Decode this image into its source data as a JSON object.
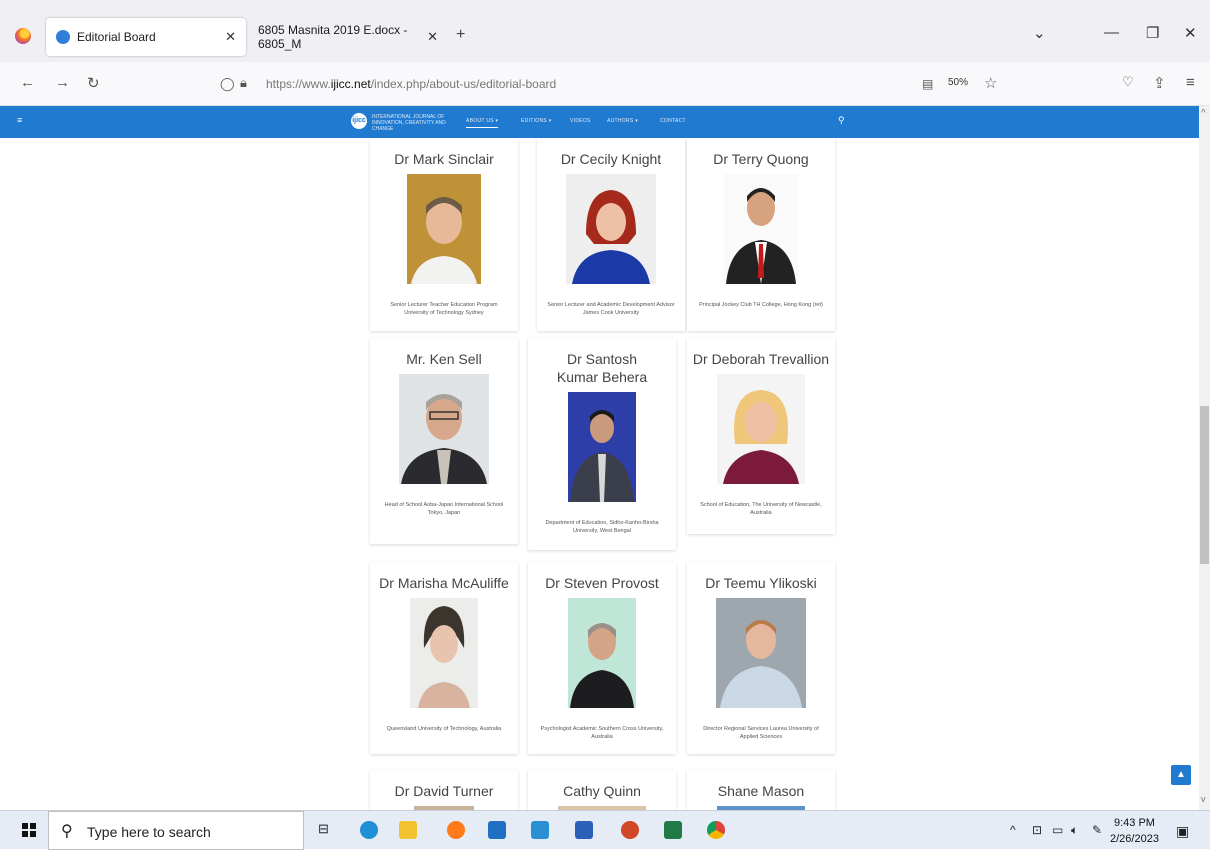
{
  "browser": {
    "tabs": [
      {
        "title": "Editorial Board",
        "active": true
      },
      {
        "title": "6805 Masnita 2019 E.docx - 6805_M",
        "active": false
      }
    ],
    "url_prefix": "https://www.",
    "url_domain": "ijicc.net",
    "url_path": "/index.php/about-us/editorial-board",
    "zoom": "50%"
  },
  "site": {
    "brand_line1": "INTERNATIONAL JOURNAL OF",
    "brand_line2": "INNOVATION, CREATIVITY AND CHANGE",
    "menu": [
      "ABOUT US ▾",
      "EDITIONS ▾",
      "VIDEOS",
      "AUTHORS ▾",
      "CONTACT"
    ]
  },
  "board": [
    {
      "name": "Dr Mark Sinclair",
      "role": "Senior Lecturer Teacher Education Program University of Technology Sydney"
    },
    {
      "name": "Dr Cecily Knight",
      "role": "Senior Lecturer and Academic Development Advisor James Cook University"
    },
    {
      "name": "Dr Terry Quong",
      "role": "Principal Jockey Club TH College, Hong Kong (ret)"
    },
    {
      "name": "Mr. Ken Sell",
      "role": "Head of School Aoba-Japan International School Tokyo, Japan"
    },
    {
      "name": "Dr Santosh Kumar Behera",
      "role": "Department of Education, Sidho-Kanho-Birsha University, West Bengal"
    },
    {
      "name": "Dr Deborah Trevallion",
      "role": "School of Education, The University of Newcastle, Australia"
    },
    {
      "name": "Dr Marisha McAuliffe",
      "role": "Queensland University of Technology, Australia"
    },
    {
      "name": "Dr Steven Provost",
      "role": "Psychologist Academic Southern Cross University, Australia"
    },
    {
      "name": "Dr Teemu Ylikoski",
      "role": "Director Regional Services Laurea University of Applied Sciences"
    },
    {
      "name": "Dr David Turner",
      "role": ""
    },
    {
      "name": "Cathy Quinn",
      "role": ""
    },
    {
      "name": "Shane Mason",
      "role": ""
    }
  ],
  "taskbar": {
    "search_placeholder": "Type here to search",
    "time": "9:43 PM",
    "date": "2/26/2023"
  },
  "icons": {
    "back": "arrow-left-icon",
    "forward": "arrow-right-icon",
    "reload": "reload-icon"
  }
}
